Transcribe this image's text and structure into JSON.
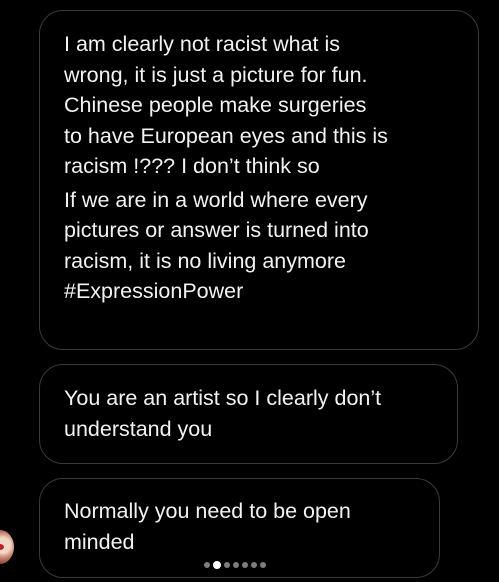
{
  "messages": [
    {
      "paragraphs": [
        {
          "lines": [
            "I am clearly not racist what is",
            "wrong, it is just a picture for fun.",
            "Chinese people make surgeries",
            "to have European eyes and this is",
            "racism !??? I don’t think so"
          ]
        },
        {
          "lines": [
            "If we are in a world where every",
            "pictures or answer is turned into",
            "racism, it is no living anymore",
            "#ExpressionPower"
          ]
        }
      ]
    },
    {
      "lines": [
        "You are an artist so I clearly don’t",
        "understand you"
      ]
    },
    {
      "lines": [
        "Normally you need to be open",
        "minded"
      ]
    }
  ],
  "pagination": {
    "total": 7,
    "active_index": 1
  },
  "colors": {
    "background": "#000000",
    "bubble_border": "#3a3a3c",
    "text": "#f2f2f2",
    "dot_inactive": "#7d7d7d",
    "dot_active": "#ffffff"
  }
}
